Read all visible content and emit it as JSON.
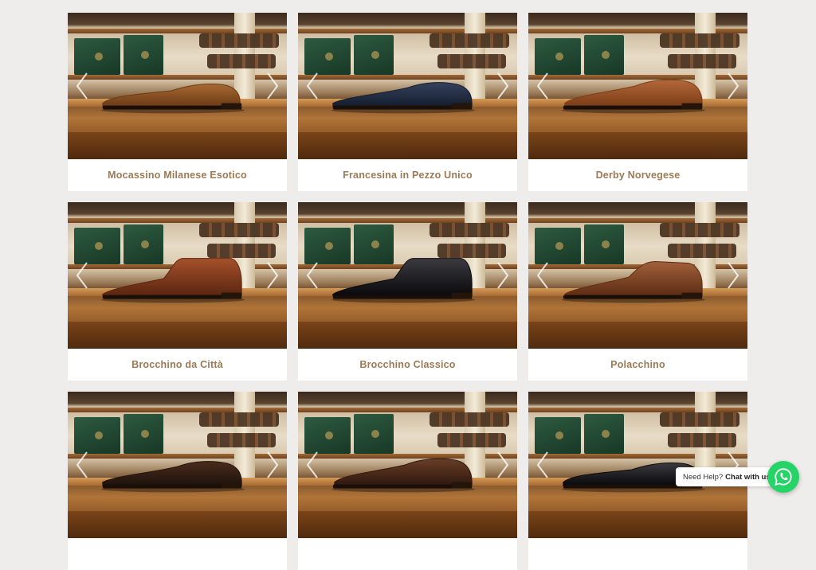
{
  "products": [
    {
      "name": "Mocassino Milanese Esotico",
      "style": "loafer",
      "leather": "croc-tan"
    },
    {
      "name": "Francesina in Pezzo Unico",
      "style": "oxford",
      "leather": "croc-navy"
    },
    {
      "name": "Derby Norvegese",
      "style": "derby",
      "leather": "polished-tan"
    },
    {
      "name": "Brocchino da Città",
      "style": "chelsea",
      "leather": "croc-brown"
    },
    {
      "name": "Brocchino Classico",
      "style": "chelsea",
      "leather": "polished-black"
    },
    {
      "name": "Polacchino",
      "style": "chukka",
      "leather": "polished-brown"
    },
    {
      "name": "",
      "style": "oxford",
      "leather": "polished-darkbrown"
    },
    {
      "name": "",
      "style": "derby",
      "leather": "polished-chocolate"
    },
    {
      "name": "",
      "style": "loafer",
      "leather": "polished-black"
    }
  ],
  "leather_colors": {
    "croc-tan": [
      "#6b3a16",
      "#a86a32"
    ],
    "croc-navy": [
      "#151d2e",
      "#35425c"
    ],
    "polished-tan": [
      "#7a3c16",
      "#b5683a"
    ],
    "croc-brown": [
      "#5a2510",
      "#a5512a"
    ],
    "polished-black": [
      "#0a0a0c",
      "#3a3a40"
    ],
    "polished-brown": [
      "#5c2c14",
      "#a2603a"
    ],
    "polished-darkbrown": [
      "#1e120c",
      "#4a2c1c"
    ],
    "polished-chocolate": [
      "#2e1810",
      "#6a3e26"
    ]
  },
  "chat": {
    "help_text": "Need Help?",
    "cta_text": "Chat with us",
    "icon": "whatsapp-icon",
    "color": "#25d366"
  },
  "colors": {
    "background": "#efedeb",
    "label": "#9c7a55"
  }
}
